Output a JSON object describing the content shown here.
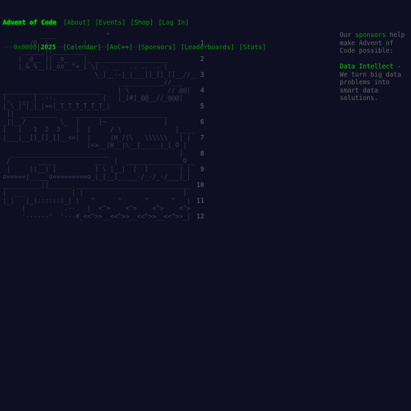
{
  "header": {
    "title": "Advent of Code",
    "year_prefix": "0x0000|",
    "year": "2025",
    "nav_row1": [
      "[About]",
      "[Events]",
      "[Shop]",
      "[Log In]"
    ],
    "nav_row2": [
      "[Calendar]",
      "[AoC++]",
      "[Sponsors]",
      "[Leaderboards]",
      "[Stats]"
    ]
  },
  "calendar": {
    "rows": [
      {
        "art": "          ____             *                 ",
        "day": ""
      },
      {
        "art": "_______/O__\\_________|____________________",
        "day": "1"
      },
      {
        "art": "     ______||_________                    ",
        "day": ""
      },
      {
        "art": "    | _@__ || _o_    |_ ___________________",
        "day": "2"
      },
      {
        "art": "    |_&_%__||_oo__^=_[ \\|    _   .. .. .. |",
        "day": ""
      },
      {
        "art": "                        \\_]__--|_|___[]_[]_[]__//_|",
        "day": "3"
      },
      {
        "art": "                               ___________//___",
        "day": ""
      },
      {
        "art": "__________________________    | \\          // @@|",
        "day": "4"
      },
      {
        "art": "|_  ___ | .--.            |   |_[#]_@@__//_@@@|",
        "day": ""
      },
      {
        "art": "|_\\_|^|_|_|==|_T_T_T_T_T_T_|                    ",
        "day": "5"
      },
      {
        "art": " ||  _________    _________________________   ",
        "day": ""
      },
      {
        "art": "_||__/         \\_  |     |~               |   ",
        "day": "6"
      },
      {
        "art": "|   |   1  2  3    |  |     / \\              |____",
        "day": ""
      },
      {
        "art": "|___|__[]_[]_[]__<>|  |     |H_/|\\   \\\\\\\\\\\\   | | |",
        "day": "7"
      },
      {
        "art": "                      |<>__|H__|\\__|_____|_[_O_|",
        "day": ""
      },
      {
        "art": "  __________________________                  |",
        "day": "8"
      },
      {
        "art": " /       _____          ___  |  _______________O__",
        "day": ""
      },
      {
        "art": " |     |(__) [          ] \\ |__|  [  ]        | |",
        "day": "9"
      },
      {
        "art": "o=====|_____o=========o_|_[__]_____-/_-/_-/___|_|",
        "day": ""
      },
      {
        "art": "__________||______ ______________________________",
        "day": "10"
      },
      {
        "art": "|  ___            | |                          |",
        "day": ""
      },
      {
        "art": "|_|   |_(::::::)_| |   ^      ^      ^      ^   |",
        "day": "11"
      },
      {
        "art": "     |          .--.  |  <^>    <^>    <^>    <^>  |",
        "day": ""
      },
      {
        "art": "     '------'  '---#_<<^>>__<<^>>__<<^>>__<<^>>_|",
        "day": "12"
      }
    ]
  },
  "sidebar": {
    "intro_before": "Our ",
    "intro_link": "sponsors",
    "intro_after": " help make Advent of Code possible:",
    "sponsor_name": "Data Intellect",
    "sponsor_text": " - We turn big data problems into smart data solutions."
  },
  "colors": {
    "background": "#0f0f23",
    "accent_green": "#00cc00",
    "link_green": "#009900",
    "text_gray": "#cccccc"
  }
}
